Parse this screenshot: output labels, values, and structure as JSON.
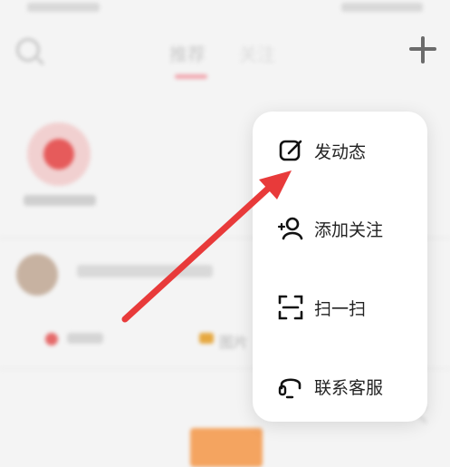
{
  "background": {
    "tab_left": "推荐",
    "tab_right": "关注",
    "image_label": "图片"
  },
  "menu": {
    "items": [
      {
        "label": "发动态",
        "icon": "edit-icon"
      },
      {
        "label": "添加关注",
        "icon": "add-user-icon"
      },
      {
        "label": "扫一扫",
        "icon": "scan-icon"
      },
      {
        "label": "联系客服",
        "icon": "headset-icon"
      }
    ]
  },
  "colors": {
    "arrow": "#e83a3a",
    "menu_bg": "#ffffff",
    "dim_overlay": "#f4f4f4"
  }
}
